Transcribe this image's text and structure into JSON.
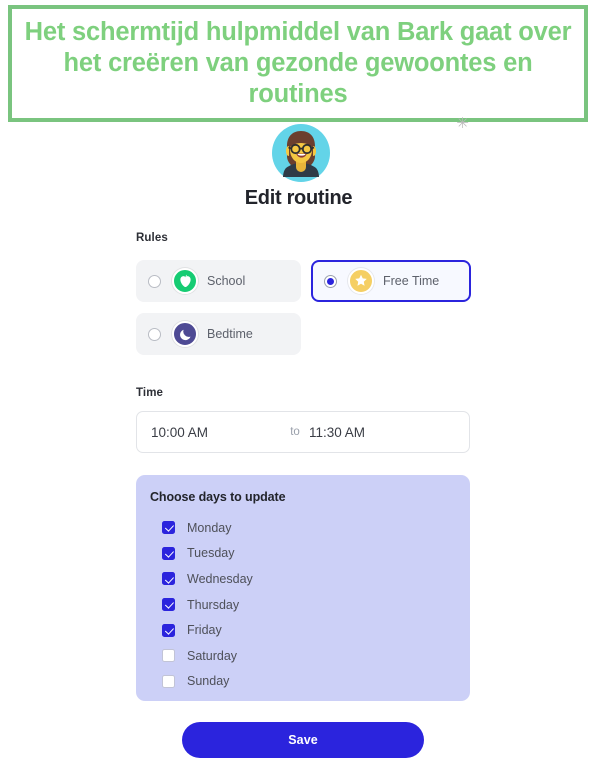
{
  "banner": {
    "text": "Het schermtijd hulpmiddel van Bark gaat over het creëren van gezonde gewoontes en routines",
    "border_color": "#7ac47f",
    "text_color": "#7ed07e",
    "mark": "✳"
  },
  "avatar": {
    "icon_name": "user-avatar-girl-glasses",
    "background_color": "#63d4e8",
    "hair_color": "#6b3f2e",
    "face_color": "#f5c842"
  },
  "screen": {
    "title": "Edit routine"
  },
  "rules": {
    "label": "Rules",
    "options": [
      {
        "label": "School",
        "icon": "apple-icon",
        "icon_color": "#16cc73",
        "selected": false
      },
      {
        "label": "Free Time",
        "icon": "star-icon",
        "icon_color": "#f5cf64",
        "selected": true
      },
      {
        "label": "Bedtime",
        "icon": "moon-icon",
        "icon_color": "#4e4a94",
        "selected": false
      }
    ],
    "selected_value": "Free Time",
    "accent_color": "#2b24dd"
  },
  "time": {
    "label": "Time",
    "start_value": "10:00 AM",
    "separator": "to",
    "end_value": "11:30 AM",
    "start_placeholder": "Start time",
    "end_placeholder": "End time"
  },
  "days": {
    "title": "Choose days to update",
    "panel_color": "#ccd0f7",
    "items": [
      {
        "label": "Monday",
        "checked": true
      },
      {
        "label": "Tuesday",
        "checked": true
      },
      {
        "label": "Wednesday",
        "checked": true
      },
      {
        "label": "Thursday",
        "checked": true
      },
      {
        "label": "Friday",
        "checked": true
      },
      {
        "label": "Saturday",
        "checked": false
      },
      {
        "label": "Sunday",
        "checked": false
      }
    ]
  },
  "footer": {
    "save_label": "Save",
    "save_color": "#2b24dd"
  }
}
